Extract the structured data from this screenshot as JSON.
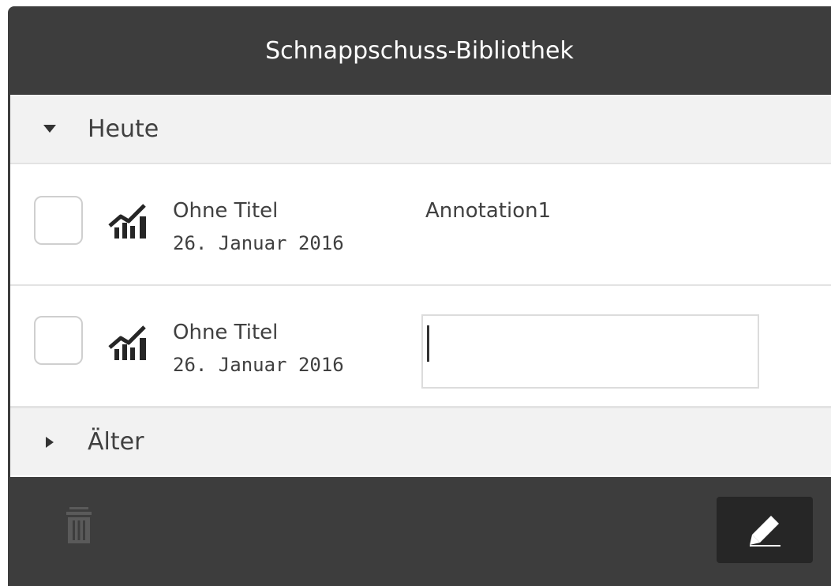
{
  "dialog": {
    "title": "Schnappschuss-Bibliothek"
  },
  "groups": [
    {
      "label": "Heute",
      "expanded": true,
      "caret_icon": "caret-down-icon"
    },
    {
      "label": "Älter",
      "expanded": false,
      "caret_icon": "caret-right-icon"
    }
  ],
  "snapshots": [
    {
      "title": "Ohne Titel",
      "date": "26. Januar 2016",
      "annotation": "Annotation1",
      "icon": "chart-snapshot-icon",
      "checked": false
    },
    {
      "title": "Ohne Titel",
      "date": "26. Januar 2016",
      "annotation_input_value": "",
      "icon": "chart-snapshot-icon",
      "checked": false
    }
  ],
  "footer": {
    "delete_icon": "trash-icon",
    "delete_enabled": false,
    "edit_icon": "pencil-icon"
  },
  "colors": {
    "header_bg": "#3d3d3d",
    "group_bg": "#f2f2f2",
    "text": "#404040",
    "edit_button_bg": "#262626"
  }
}
